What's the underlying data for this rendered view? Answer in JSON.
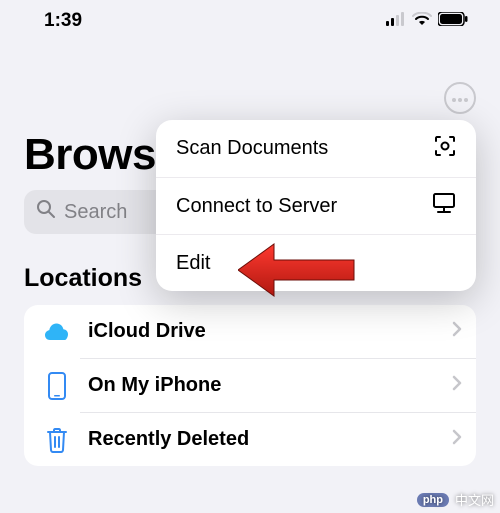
{
  "status": {
    "time": "1:39"
  },
  "header": {
    "title": "Browse"
  },
  "search": {
    "placeholder": "Search"
  },
  "popup": {
    "items": [
      {
        "label": "Scan Documents"
      },
      {
        "label": "Connect to Server"
      },
      {
        "label": "Edit"
      }
    ]
  },
  "locations": {
    "header": "Locations",
    "items": [
      {
        "label": "iCloud Drive"
      },
      {
        "label": "On My iPhone"
      },
      {
        "label": "Recently Deleted"
      }
    ]
  },
  "watermark": {
    "badge": "php",
    "text": "中文网"
  }
}
